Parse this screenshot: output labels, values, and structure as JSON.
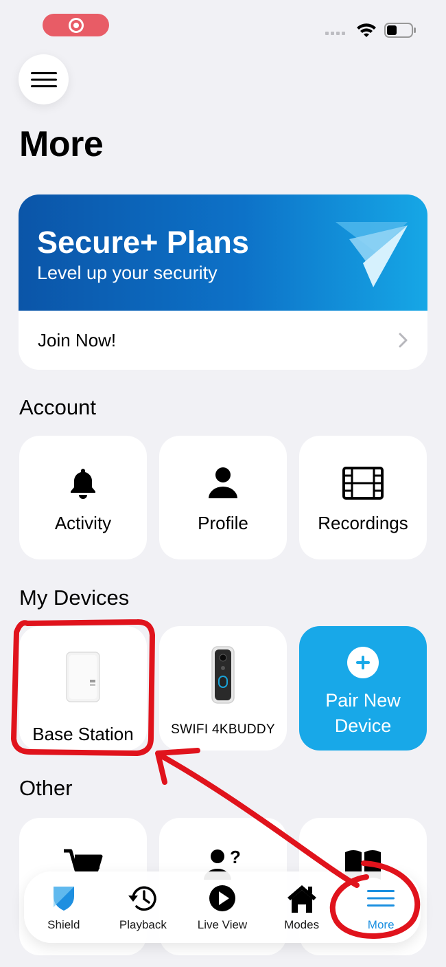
{
  "app": {
    "page_title": "More"
  },
  "icons": {
    "menu": "hamburger-icon",
    "bell": "bell-icon",
    "profile": "person-icon",
    "recordings": "film-icon",
    "shop": "cart-icon",
    "support": "person-question-icon",
    "guides": "book-icon",
    "shield": "shield-icon",
    "playback": "history-icon",
    "liveview": "play-circle-icon",
    "modes": "home-icon",
    "more": "lines-icon"
  },
  "colors": {
    "accent": "#18a8e8",
    "banner_start": "#0b55a8",
    "banner_end": "#16a7e6",
    "annotation": "#e0131c"
  },
  "plans": {
    "title": "Secure+ Plans",
    "subtitle": "Level up your security",
    "join_label": "Join Now!"
  },
  "account": {
    "title": "Account",
    "items": [
      {
        "label": "Activity"
      },
      {
        "label": "Profile"
      },
      {
        "label": "Recordings"
      }
    ]
  },
  "devices": {
    "title": "My Devices",
    "items": [
      {
        "label": "Base Station"
      },
      {
        "label": "SWIFI 4KBUDDY"
      }
    ],
    "pair": {
      "line1": "Pair New",
      "line2": "Device"
    }
  },
  "other": {
    "title": "Other"
  },
  "tabs": [
    {
      "label": "Shield"
    },
    {
      "label": "Playback"
    },
    {
      "label": "Live View"
    },
    {
      "label": "Modes"
    },
    {
      "label": "More"
    }
  ]
}
